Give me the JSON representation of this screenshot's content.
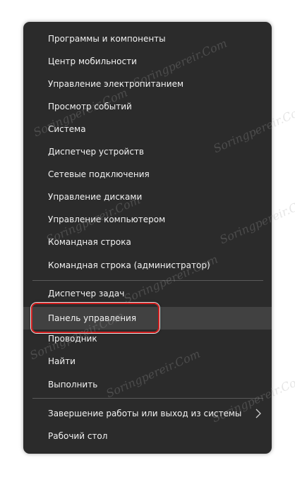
{
  "menu": {
    "items": [
      {
        "label": "Программы и компоненты"
      },
      {
        "label": "Центр мобильности"
      },
      {
        "label": "Управление электропитанием"
      },
      {
        "label": "Просмотр событий"
      },
      {
        "label": "Система"
      },
      {
        "label": "Диспетчер устройств"
      },
      {
        "label": "Сетевые подключения"
      },
      {
        "label": "Управление дисками"
      },
      {
        "label": "Управление компьютером"
      },
      {
        "label": "Командная строка"
      },
      {
        "label": "Командная строка (администратор)"
      },
      {
        "label": "Диспетчер задач"
      },
      {
        "label": "Панель управления"
      },
      {
        "label": "Проводник"
      },
      {
        "label": "Найти"
      },
      {
        "label": "Выполнить"
      },
      {
        "label": "Завершение работы или выход из системы"
      },
      {
        "label": "Рабочий стол"
      }
    ],
    "highlighted_item": "Панель управления",
    "submenu_icon": "chevron-right-icon"
  },
  "watermark": {
    "text": "Sоringрerеir.Com"
  },
  "colors": {
    "menu_background": "#2b2b2b",
    "highlight_background": "#414141",
    "text": "#f2f2f2",
    "annotation_border": "#d21e1e"
  }
}
